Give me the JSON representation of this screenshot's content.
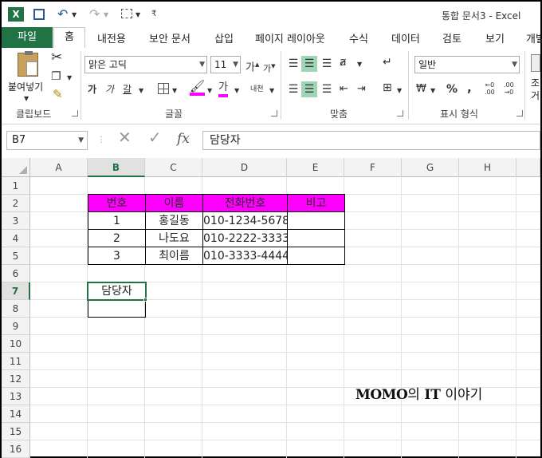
{
  "titlebar": {
    "title": "통합 문서3 - Excel",
    "app_icon": "excel-icon",
    "quick_access": [
      "save-icon",
      "undo-icon",
      "redo-icon",
      "selection-icon",
      "customize-icon"
    ]
  },
  "ribbon_tabs": {
    "file": "파일",
    "items": [
      "홈",
      "내전용",
      "보안 문서",
      "삽입",
      "페이지 레이아웃",
      "수식",
      "데이터",
      "검토",
      "보기",
      "개발"
    ]
  },
  "ribbon": {
    "clipboard": {
      "paste": "붙여넣기",
      "group": "클립보드"
    },
    "font": {
      "name": "맑은 고딕",
      "size": "11",
      "bold": "가",
      "italic": "가",
      "underline": "갈",
      "text_wrap": "내천",
      "group": "글꼴"
    },
    "alignment": {
      "group": "맞춤"
    },
    "number": {
      "format": "일반",
      "group": "표시 형식",
      "percent": "%",
      "comma": ","
    },
    "styles": {
      "partial": "조거 서"
    }
  },
  "formula_bar": {
    "name_box": "B7",
    "content": "담당자",
    "fx": "fx"
  },
  "grid": {
    "columns": [
      "A",
      "B",
      "C",
      "D",
      "E",
      "F",
      "G",
      "H"
    ],
    "selected_column": "B",
    "rows": [
      "1",
      "2",
      "3",
      "4",
      "5",
      "6",
      "7",
      "8",
      "9",
      "10",
      "11",
      "12",
      "13",
      "14",
      "15",
      "16"
    ],
    "selected_row": "7"
  },
  "table": {
    "headers": [
      "번호",
      "이름",
      "전화번호",
      "비고"
    ],
    "rows": [
      [
        "1",
        "홍길동",
        "010-1234-5678",
        ""
      ],
      [
        "2",
        "나도요",
        "010-2222-3333",
        ""
      ],
      [
        "3",
        "최이름",
        "010-3333-4444",
        ""
      ]
    ],
    "header_color": "#ff00ff"
  },
  "cells": {
    "b7": "담당자"
  },
  "watermark": {
    "brand": "MOMO",
    "particle": "의",
    "it": "IT",
    "suffix": " 이야기"
  },
  "colors": {
    "excel_green": "#217346",
    "highlight": "#9fd5b7"
  }
}
